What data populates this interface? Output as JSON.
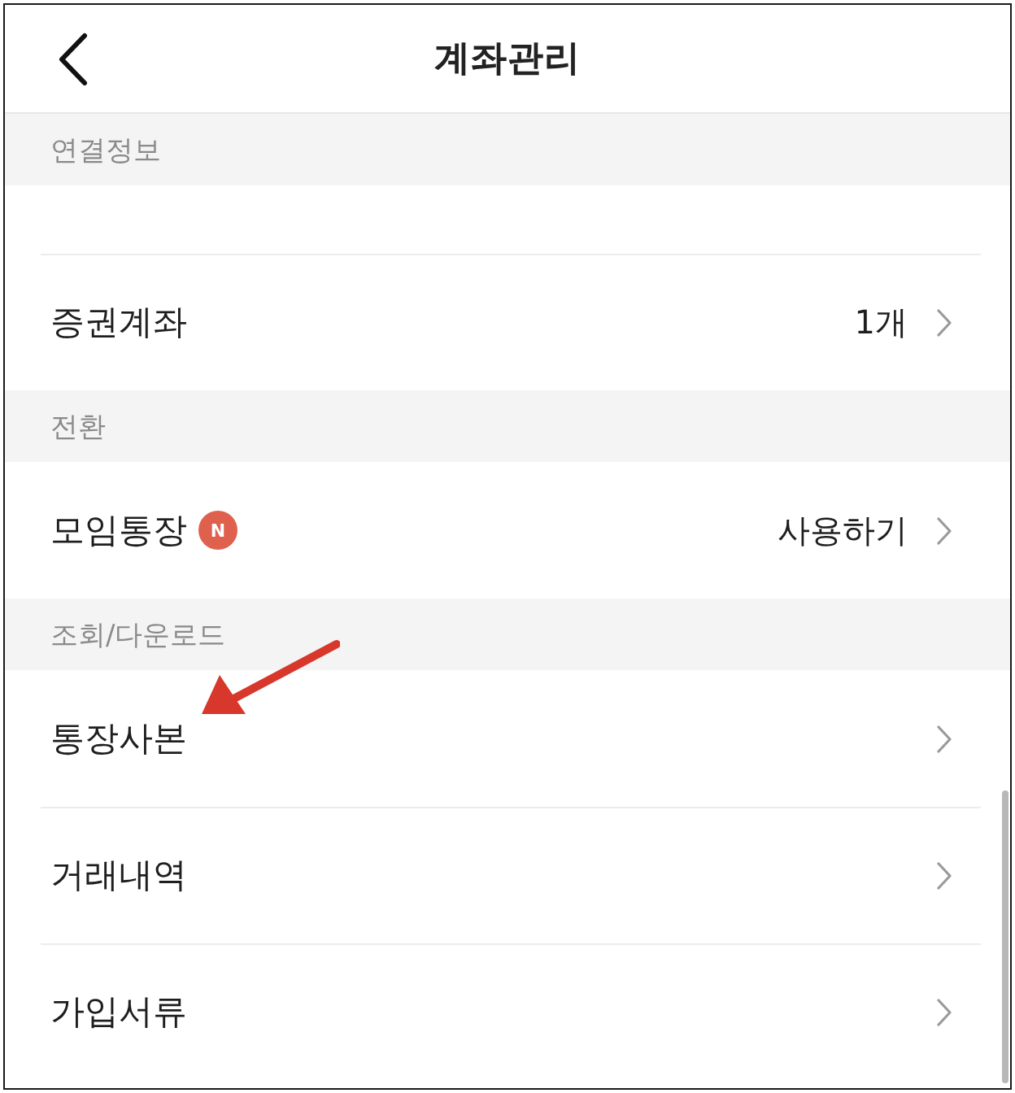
{
  "header": {
    "title": "계좌관리"
  },
  "sections": [
    {
      "title": "연결정보",
      "items": [
        {
          "kind": "cut"
        },
        {
          "kind": "row",
          "label": "증권계좌",
          "value": "1개",
          "arrow": false
        }
      ]
    },
    {
      "title": "전환",
      "items": [
        {
          "kind": "row",
          "label": "모임통장",
          "badge": "N",
          "value": "사용하기",
          "arrow": false
        }
      ]
    },
    {
      "title": "조회/다운로드",
      "items": [
        {
          "kind": "row",
          "label": "통장사본",
          "arrow": true
        },
        {
          "kind": "row",
          "label": "거래내역",
          "arrow": false
        },
        {
          "kind": "row",
          "label": "가입서류",
          "arrow": false
        }
      ]
    }
  ]
}
